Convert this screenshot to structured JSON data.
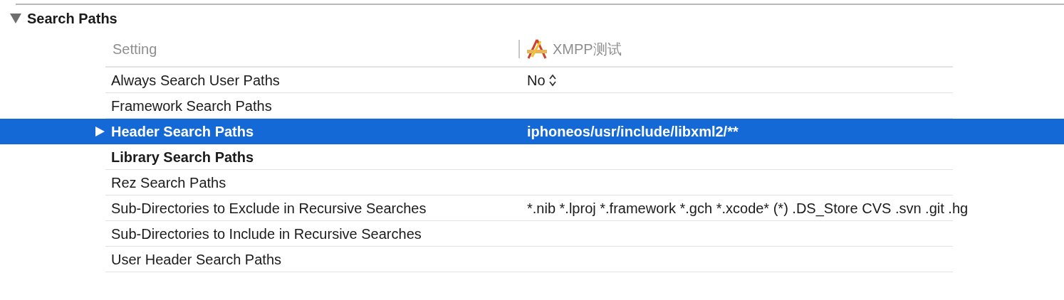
{
  "section": {
    "title": "Search Paths",
    "expanded": true
  },
  "columns": {
    "setting": "Setting",
    "target": "XMPP测试"
  },
  "rows": [
    {
      "name": "Always Search User Paths",
      "bold": false,
      "selected": false,
      "expandable": false,
      "kind": "popup",
      "value": "No"
    },
    {
      "name": "Framework Search Paths",
      "bold": false,
      "selected": false,
      "expandable": false
    },
    {
      "name": "Header Search Paths",
      "bold": true,
      "selected": true,
      "expandable": true,
      "kind": "text",
      "value": "iphoneos/usr/include/libxml2/**"
    },
    {
      "name": "Library Search Paths",
      "bold": true,
      "selected": false,
      "expandable": false
    },
    {
      "name": "Rez Search Paths",
      "bold": false,
      "selected": false,
      "expandable": false
    },
    {
      "name": "Sub-Directories to Exclude in Recursive Searches",
      "bold": false,
      "selected": false,
      "expandable": false,
      "kind": "text",
      "value": "*.nib *.lproj *.framework *.gch *.xcode* (*) .DS_Store CVS .svn .git .hg"
    },
    {
      "name": "Sub-Directories to Include in Recursive Searches",
      "bold": false,
      "selected": false,
      "expandable": false
    },
    {
      "name": "User Header Search Paths",
      "bold": false,
      "selected": false,
      "expandable": false
    }
  ]
}
